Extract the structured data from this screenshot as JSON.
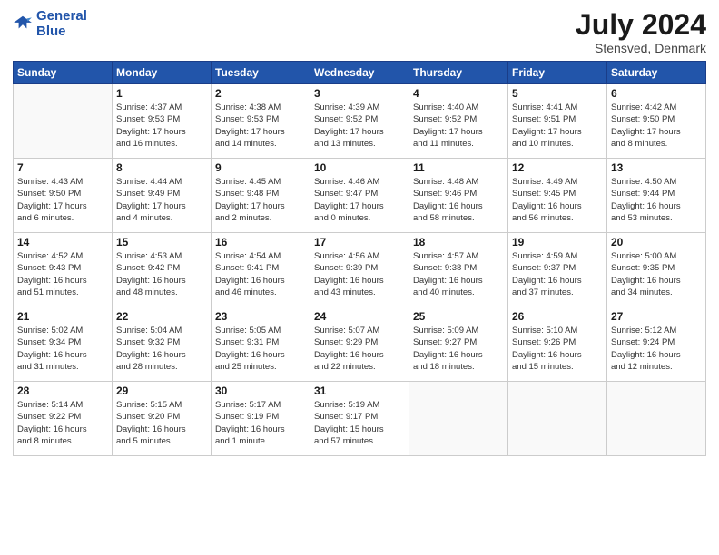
{
  "header": {
    "logo_general": "General",
    "logo_blue": "Blue",
    "month_year": "July 2024",
    "location": "Stensved, Denmark"
  },
  "weekdays": [
    "Sunday",
    "Monday",
    "Tuesday",
    "Wednesday",
    "Thursday",
    "Friday",
    "Saturday"
  ],
  "weeks": [
    [
      {
        "day": null,
        "info": null
      },
      {
        "day": "1",
        "info": "Sunrise: 4:37 AM\nSunset: 9:53 PM\nDaylight: 17 hours\nand 16 minutes."
      },
      {
        "day": "2",
        "info": "Sunrise: 4:38 AM\nSunset: 9:53 PM\nDaylight: 17 hours\nand 14 minutes."
      },
      {
        "day": "3",
        "info": "Sunrise: 4:39 AM\nSunset: 9:52 PM\nDaylight: 17 hours\nand 13 minutes."
      },
      {
        "day": "4",
        "info": "Sunrise: 4:40 AM\nSunset: 9:52 PM\nDaylight: 17 hours\nand 11 minutes."
      },
      {
        "day": "5",
        "info": "Sunrise: 4:41 AM\nSunset: 9:51 PM\nDaylight: 17 hours\nand 10 minutes."
      },
      {
        "day": "6",
        "info": "Sunrise: 4:42 AM\nSunset: 9:50 PM\nDaylight: 17 hours\nand 8 minutes."
      }
    ],
    [
      {
        "day": "7",
        "info": "Sunrise: 4:43 AM\nSunset: 9:50 PM\nDaylight: 17 hours\nand 6 minutes."
      },
      {
        "day": "8",
        "info": "Sunrise: 4:44 AM\nSunset: 9:49 PM\nDaylight: 17 hours\nand 4 minutes."
      },
      {
        "day": "9",
        "info": "Sunrise: 4:45 AM\nSunset: 9:48 PM\nDaylight: 17 hours\nand 2 minutes."
      },
      {
        "day": "10",
        "info": "Sunrise: 4:46 AM\nSunset: 9:47 PM\nDaylight: 17 hours\nand 0 minutes."
      },
      {
        "day": "11",
        "info": "Sunrise: 4:48 AM\nSunset: 9:46 PM\nDaylight: 16 hours\nand 58 minutes."
      },
      {
        "day": "12",
        "info": "Sunrise: 4:49 AM\nSunset: 9:45 PM\nDaylight: 16 hours\nand 56 minutes."
      },
      {
        "day": "13",
        "info": "Sunrise: 4:50 AM\nSunset: 9:44 PM\nDaylight: 16 hours\nand 53 minutes."
      }
    ],
    [
      {
        "day": "14",
        "info": "Sunrise: 4:52 AM\nSunset: 9:43 PM\nDaylight: 16 hours\nand 51 minutes."
      },
      {
        "day": "15",
        "info": "Sunrise: 4:53 AM\nSunset: 9:42 PM\nDaylight: 16 hours\nand 48 minutes."
      },
      {
        "day": "16",
        "info": "Sunrise: 4:54 AM\nSunset: 9:41 PM\nDaylight: 16 hours\nand 46 minutes."
      },
      {
        "day": "17",
        "info": "Sunrise: 4:56 AM\nSunset: 9:39 PM\nDaylight: 16 hours\nand 43 minutes."
      },
      {
        "day": "18",
        "info": "Sunrise: 4:57 AM\nSunset: 9:38 PM\nDaylight: 16 hours\nand 40 minutes."
      },
      {
        "day": "19",
        "info": "Sunrise: 4:59 AM\nSunset: 9:37 PM\nDaylight: 16 hours\nand 37 minutes."
      },
      {
        "day": "20",
        "info": "Sunrise: 5:00 AM\nSunset: 9:35 PM\nDaylight: 16 hours\nand 34 minutes."
      }
    ],
    [
      {
        "day": "21",
        "info": "Sunrise: 5:02 AM\nSunset: 9:34 PM\nDaylight: 16 hours\nand 31 minutes."
      },
      {
        "day": "22",
        "info": "Sunrise: 5:04 AM\nSunset: 9:32 PM\nDaylight: 16 hours\nand 28 minutes."
      },
      {
        "day": "23",
        "info": "Sunrise: 5:05 AM\nSunset: 9:31 PM\nDaylight: 16 hours\nand 25 minutes."
      },
      {
        "day": "24",
        "info": "Sunrise: 5:07 AM\nSunset: 9:29 PM\nDaylight: 16 hours\nand 22 minutes."
      },
      {
        "day": "25",
        "info": "Sunrise: 5:09 AM\nSunset: 9:27 PM\nDaylight: 16 hours\nand 18 minutes."
      },
      {
        "day": "26",
        "info": "Sunrise: 5:10 AM\nSunset: 9:26 PM\nDaylight: 16 hours\nand 15 minutes."
      },
      {
        "day": "27",
        "info": "Sunrise: 5:12 AM\nSunset: 9:24 PM\nDaylight: 16 hours\nand 12 minutes."
      }
    ],
    [
      {
        "day": "28",
        "info": "Sunrise: 5:14 AM\nSunset: 9:22 PM\nDaylight: 16 hours\nand 8 minutes."
      },
      {
        "day": "29",
        "info": "Sunrise: 5:15 AM\nSunset: 9:20 PM\nDaylight: 16 hours\nand 5 minutes."
      },
      {
        "day": "30",
        "info": "Sunrise: 5:17 AM\nSunset: 9:19 PM\nDaylight: 16 hours\nand 1 minute."
      },
      {
        "day": "31",
        "info": "Sunrise: 5:19 AM\nSunset: 9:17 PM\nDaylight: 15 hours\nand 57 minutes."
      },
      {
        "day": null,
        "info": null
      },
      {
        "day": null,
        "info": null
      },
      {
        "day": null,
        "info": null
      }
    ]
  ]
}
